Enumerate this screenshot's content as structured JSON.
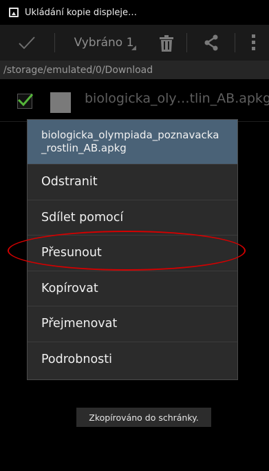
{
  "status_bar": {
    "notification_text": "Ukládání kopie displeje…",
    "icon": "screenshot-icon"
  },
  "action_bar": {
    "done_icon": "checkmark-icon",
    "selected_label": "Vybráno 1",
    "delete_icon": "trash-icon",
    "share_icon": "share-icon",
    "overflow_icon": "overflow-menu-icon"
  },
  "path": "/storage/emulated/0/Download",
  "file": {
    "checked": true,
    "name": "biologicka_oly…tlin_AB.apkg"
  },
  "context_menu": {
    "title": "biologicka_olympiada_poznavacka_rostlin_AB.apkg",
    "items": [
      {
        "label": "Odstranit"
      },
      {
        "label": "Sdílet pomocí"
      },
      {
        "label": "Přesunout",
        "highlighted": true
      },
      {
        "label": "Kopírovat"
      },
      {
        "label": "Přejmenovat"
      },
      {
        "label": "Podrobnosti"
      }
    ]
  },
  "toast": {
    "text": "Zkopírováno do schránky."
  },
  "colors": {
    "menu_title_bg": "#4a6277",
    "checkbox_green": "#55b63a",
    "annotation_red": "#d40000"
  }
}
